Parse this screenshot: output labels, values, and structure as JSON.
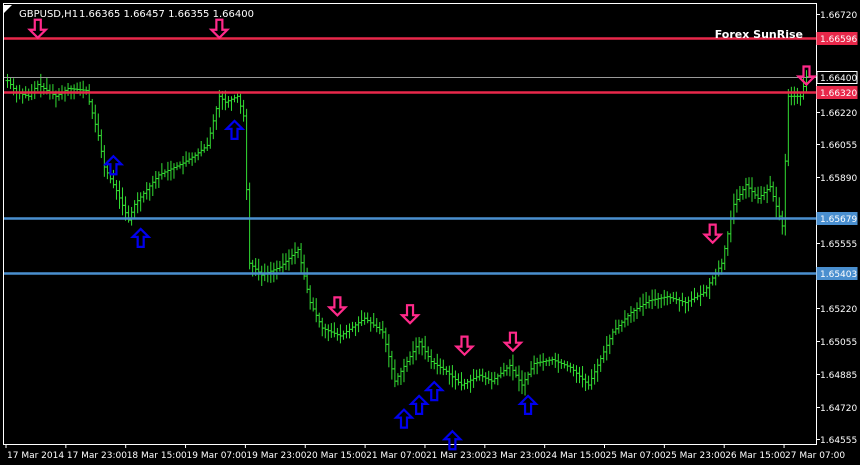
{
  "header": {
    "symbol_label": "GBPUSD,H1",
    "ohlc_text": "1.66365 1.66457 1.66355 1.66400",
    "watermark": "Forex SunRise"
  },
  "colors": {
    "background": "#000000",
    "border": "#ffffff",
    "candles": "#33dd33",
    "resistance_line": "#e8284a",
    "support_line": "#4a8fcf",
    "bid_line": "#9a9a9a",
    "sell_arrow": "#ff2a8a",
    "buy_arrow": "#0000ee",
    "text": "#ffffff"
  },
  "chart_data": {
    "type": "ohlc",
    "symbol": "GBPUSD",
    "timeframe": "H1",
    "y_range": [
      1.6453,
      1.6677
    ],
    "y_ticks": [
      "1.66720",
      "1.66596",
      "1.66400",
      "1.66320",
      "1.66220",
      "1.66055",
      "1.65890",
      "1.65679",
      "1.65555",
      "1.65403",
      "1.65220",
      "1.65055",
      "1.64885",
      "1.64720",
      "1.64555"
    ],
    "x_ticks": [
      "17 Mar 2014",
      "17 Mar 23:00",
      "18 Mar 15:00",
      "19 Mar 07:00",
      "19 Mar 23:00",
      "20 Mar 15:00",
      "21 Mar 07:00",
      "21 Mar 23:00",
      "23 Mar 23:00",
      "24 Mar 15:00",
      "25 Mar 07:00",
      "25 Mar 23:00",
      "26 Mar 15:00",
      "27 Mar 07:00"
    ],
    "horizontal_lines": [
      {
        "kind": "resistance",
        "price": 1.66596,
        "label": "1.66596"
      },
      {
        "kind": "resistance",
        "price": 1.6632,
        "label": "1.66320"
      },
      {
        "kind": "support",
        "price": 1.65679,
        "label": "1.65679"
      },
      {
        "kind": "support",
        "price": 1.65403,
        "label": "1.65403"
      },
      {
        "kind": "bid",
        "price": 1.664,
        "label": "1.66400"
      }
    ],
    "close_anchors": [
      [
        0,
        1.6638
      ],
      [
        3,
        1.6632
      ],
      [
        7,
        1.663
      ],
      [
        10,
        1.6636
      ],
      [
        16,
        1.663
      ],
      [
        20,
        1.6634
      ],
      [
        26,
        1.6633
      ],
      [
        30,
        1.661
      ],
      [
        32,
        1.6594
      ],
      [
        36,
        1.6582
      ],
      [
        40,
        1.6567
      ],
      [
        42,
        1.6575
      ],
      [
        50,
        1.659
      ],
      [
        58,
        1.6596
      ],
      [
        62,
        1.66
      ],
      [
        66,
        1.6605
      ],
      [
        70,
        1.663
      ],
      [
        72,
        1.6627
      ],
      [
        76,
        1.663
      ],
      [
        78,
        1.662
      ],
      [
        80,
        1.6545
      ],
      [
        84,
        1.6539
      ],
      [
        90,
        1.6543
      ],
      [
        96,
        1.6552
      ],
      [
        100,
        1.6525
      ],
      [
        104,
        1.6512
      ],
      [
        110,
        1.6508
      ],
      [
        118,
        1.6517
      ],
      [
        124,
        1.651
      ],
      [
        128,
        1.6485
      ],
      [
        132,
        1.6495
      ],
      [
        136,
        1.6505
      ],
      [
        140,
        1.6495
      ],
      [
        145,
        1.649
      ],
      [
        150,
        1.6483
      ],
      [
        156,
        1.6488
      ],
      [
        160,
        1.6485
      ],
      [
        166,
        1.6493
      ],
      [
        170,
        1.6483
      ],
      [
        174,
        1.6494
      ],
      [
        180,
        1.6496
      ],
      [
        186,
        1.6492
      ],
      [
        192,
        1.6483
      ],
      [
        200,
        1.651
      ],
      [
        206,
        1.652
      ],
      [
        212,
        1.6526
      ],
      [
        218,
        1.6528
      ],
      [
        224,
        1.6525
      ],
      [
        230,
        1.653
      ],
      [
        236,
        1.6545
      ],
      [
        240,
        1.6575
      ],
      [
        244,
        1.6585
      ],
      [
        248,
        1.6578
      ],
      [
        252,
        1.6584
      ],
      [
        256,
        1.6564
      ],
      [
        258,
        1.663
      ],
      [
        262,
        1.663
      ],
      [
        264,
        1.664
      ]
    ],
    "signals": [
      {
        "type": "sell",
        "bar": 10,
        "price": 1.66598
      },
      {
        "type": "sell",
        "bar": 70,
        "price": 1.66598
      },
      {
        "type": "buy",
        "bar": 35,
        "price": 1.65995
      },
      {
        "type": "buy",
        "bar": 44,
        "price": 1.65625
      },
      {
        "type": "buy",
        "bar": 75,
        "price": 1.66175
      },
      {
        "type": "sell",
        "bar": 109,
        "price": 1.65185
      },
      {
        "type": "sell",
        "bar": 133,
        "price": 1.65145
      },
      {
        "type": "sell",
        "bar": 151,
        "price": 1.64985
      },
      {
        "type": "sell",
        "bar": 167,
        "price": 1.65005
      },
      {
        "type": "buy",
        "bar": 131,
        "price": 1.64705
      },
      {
        "type": "buy",
        "bar": 136,
        "price": 1.64775
      },
      {
        "type": "buy",
        "bar": 141,
        "price": 1.64845
      },
      {
        "type": "buy",
        "bar": 147,
        "price": 1.64595
      },
      {
        "type": "buy",
        "bar": 172,
        "price": 1.64775
      },
      {
        "type": "sell",
        "bar": 233,
        "price": 1.65555
      },
      {
        "type": "sell",
        "bar": 264,
        "price": 1.6636
      }
    ]
  }
}
